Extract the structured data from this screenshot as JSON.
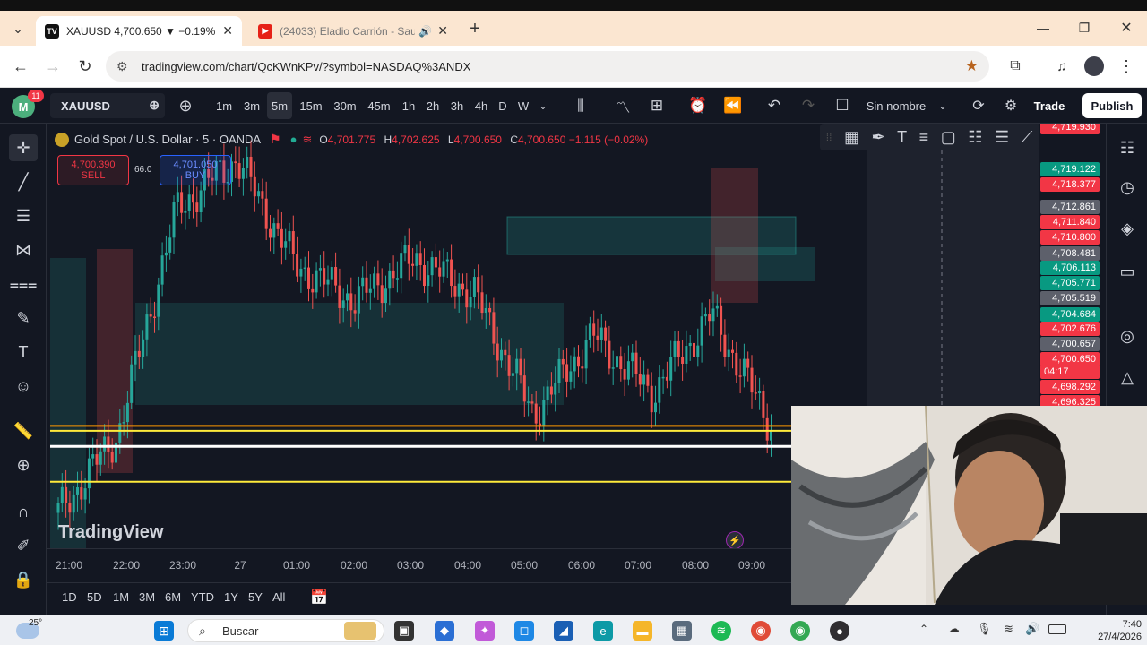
{
  "browser": {
    "tabs": [
      {
        "title": "XAUUSD 4,700.650 ▼ −0.19% S",
        "favicon": "tradingview-icon",
        "active": true
      },
      {
        "title": "(24033) Eladio Carrión - Sau",
        "favicon": "youtube-icon",
        "active": false
      }
    ],
    "new_tab_label": "+",
    "url": "tradingview.com/chart/QcKWnKPv/?symbol=NASDAQ%3ANDX"
  },
  "toolbar": {
    "notifications": "11",
    "avatar_letter": "M",
    "symbol": "XAUUSD",
    "intervals": [
      "1m",
      "3m",
      "5m",
      "15m",
      "30m",
      "45m",
      "1h",
      "2h",
      "3h",
      "4h",
      "D",
      "W"
    ],
    "selected_interval": "5m",
    "layout_name": "Sin nombre",
    "trade_label": "Trade",
    "publish_label": "Publish"
  },
  "legend": {
    "symbol_title": "Gold Spot / U.S. Dollar · 5 · OANDA",
    "o_label": "O",
    "o": "4,701.775",
    "h_label": "H",
    "h": "4,702.625",
    "l_label": "L",
    "l": "4,700.650",
    "c_label": "C",
    "c": "4,700.650 −1.115 (−0.02%)",
    "sell_price": "4,700.390",
    "sell_label": "SELL",
    "buy_price": "4,701.050",
    "buy_label": "BUY",
    "spread": "66.0"
  },
  "watermark": "TradingView",
  "price_labels": [
    {
      "text": "4,719.930",
      "color": "#f23645"
    },
    {
      "text": "4,719.122",
      "color": "#089981"
    },
    {
      "text": "4,718.377",
      "color": "#f23645"
    },
    {
      "text": "4,712.861",
      "color": "#5d606b"
    },
    {
      "text": "4,711.840",
      "color": "#f23645"
    },
    {
      "text": "4,710.800",
      "color": "#f23645"
    },
    {
      "text": "4,708.481",
      "color": "#5d606b"
    },
    {
      "text": "4,706.113",
      "color": "#089981"
    },
    {
      "text": "4,705.771",
      "color": "#089981"
    },
    {
      "text": "4,705.519",
      "color": "#5d606b"
    },
    {
      "text": "4,704.684",
      "color": "#089981"
    },
    {
      "text": "4,702.676",
      "color": "#f23645"
    },
    {
      "text": "4,700.657",
      "color": "#5d606b"
    },
    {
      "text": "4,700.650",
      "color": "#f23645"
    },
    {
      "text": "04:17",
      "color": "#f23645"
    },
    {
      "text": "4,698.292",
      "color": "#f23645"
    },
    {
      "text": "4,696.325",
      "color": "#f23645"
    }
  ],
  "time_labels": [
    "21:00",
    "22:00",
    "23:00",
    "27",
    "01:00",
    "02:00",
    "03:00",
    "04:00",
    "05:00",
    "06:00",
    "07:00",
    "08:00",
    "09:00"
  ],
  "ranges": [
    "1D",
    "5D",
    "1M",
    "3M",
    "6M",
    "YTD",
    "1Y",
    "5Y",
    "All"
  ],
  "taskbar": {
    "weather_temp": "25°",
    "search_placeholder": "Buscar",
    "time": "7:40",
    "date": "27/4/2026"
  },
  "chart_data": {
    "type": "candlestick",
    "symbol": "XAUUSD",
    "interval": "5m",
    "ohlc_last": {
      "open": 4701.775,
      "high": 4702.625,
      "low": 4700.65,
      "close": 4700.65
    },
    "x": [
      "21:00",
      "22:00",
      "23:00",
      "27",
      "01:00",
      "02:00",
      "03:00",
      "04:00",
      "05:00",
      "06:00",
      "07:00",
      "08:00",
      "09:00"
    ],
    "y_visible_range": [
      4692,
      4722
    ],
    "approx_close_path": [
      4694.5,
      4700.0,
      4716.0,
      4719.5,
      4712.0,
      4709.5,
      4712.5,
      4710.0,
      4701.5,
      4707.0,
      4703.0,
      4708.5,
      4700.65
    ],
    "horizontal_levels": [
      {
        "price": 4700.65,
        "color": "#ff9800"
      },
      {
        "price": 4700.3,
        "color": "#ffeb3b"
      },
      {
        "price": 4699.2,
        "color": "#ffffff"
      },
      {
        "price": 4696.7,
        "color": "#ffeb3b"
      },
      {
        "price": 4691.2,
        "color": "#ffeb3b"
      }
    ]
  },
  "colors": {
    "bull": "#26a69a",
    "bear": "#ef5350",
    "accent": "#2962ff"
  }
}
